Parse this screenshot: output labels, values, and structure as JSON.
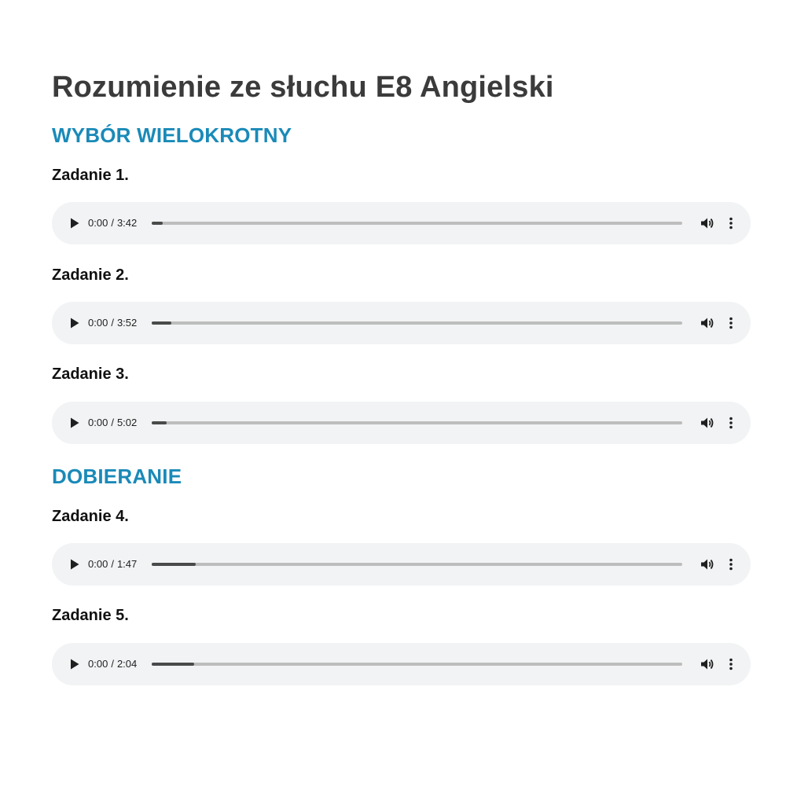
{
  "page_title": "Rozumienie ze słuchu E8 Angielski",
  "sections": [
    {
      "heading": "WYBÓR WIELOKROTNY",
      "tasks": [
        {
          "label": "Zadanie 1.",
          "current_time": "0:00",
          "duration": "3:42",
          "buffered": 0.02
        },
        {
          "label": "Zadanie 2.",
          "current_time": "0:00",
          "duration": "3:52",
          "buffered": 0.037
        },
        {
          "label": "Zadanie 3.",
          "current_time": "0:00",
          "duration": "5:02",
          "buffered": 0.028
        }
      ]
    },
    {
      "heading": "DOBIERANIE",
      "tasks": [
        {
          "label": "Zadanie 4.",
          "current_time": "0:00",
          "duration": "1:47",
          "buffered": 0.083
        },
        {
          "label": "Zadanie 5.",
          "current_time": "0:00",
          "duration": "2:04",
          "buffered": 0.08
        }
      ]
    }
  ],
  "player": {
    "time_separator": "/",
    "icons": {
      "play": "play-icon",
      "volume": "volume-icon",
      "menu": "more-vertical-icon"
    },
    "colors": {
      "background": "#f1f3f4",
      "track": "#bdbdbd",
      "progress": "#4a4a4a"
    }
  },
  "colors": {
    "title": "#3b3b3b",
    "section_heading": "#1a8ab8"
  }
}
